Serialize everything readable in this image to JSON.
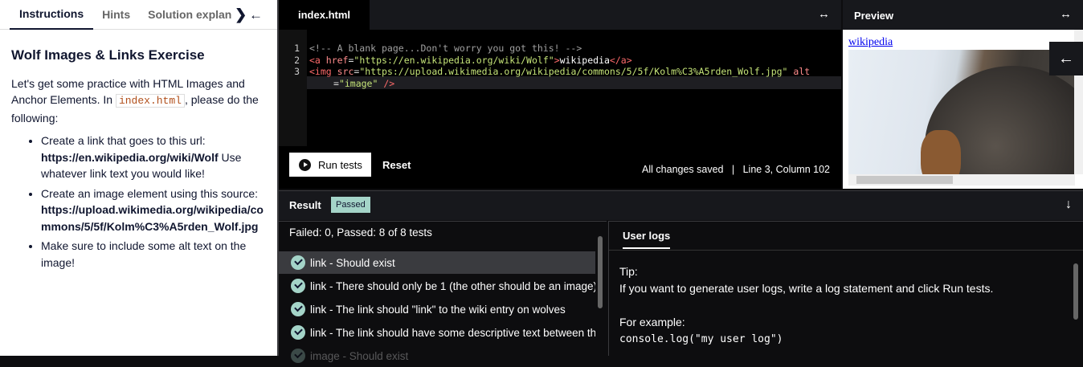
{
  "left": {
    "tabs": [
      "Instructions",
      "Hints",
      "Solution explanation"
    ],
    "title": "Wolf Images & Links Exercise",
    "intro_1": "Let's get some practice with HTML Images and Anchor Elements.  In ",
    "intro_code": "index.html",
    "intro_2": ", please do the following:",
    "bullets": [
      {
        "text": "Create a link that goes to this url: ",
        "bold": "https://en.wikipedia.org/wiki/Wolf",
        "after": " Use whatever link text you would like!"
      },
      {
        "text": "Create an image element using this source: ",
        "bold": "https://upload.wikimedia.org/wikipedia/commons/5/5f/Kolm%C3%A5rden_Wolf.jpg",
        "after": ""
      },
      {
        "text": "Make sure to include some alt text on the image!",
        "bold": "",
        "after": ""
      }
    ]
  },
  "editor": {
    "tab": "index.html",
    "lines": [
      "1",
      "2",
      "3"
    ],
    "line1": "<!-- A blank page...Don't worry you got this! -->",
    "line2": {
      "open": "<a ",
      "attr": "href",
      "eq": "=",
      "val": "\"https://en.wikipedia.org/wiki/Wolf\"",
      "close": ">",
      "text": "wikipedia",
      "end": "</a>"
    },
    "line3": {
      "open": "<img ",
      "attr": "src",
      "eq": "=",
      "val": "\"https://upload.wikimedia.org/wikipedia/commons/5/5f/Kolm%C3%A5rden_Wolf.jpg\"",
      "attr2": " alt"
    },
    "line3b": {
      "eq": "=",
      "val": "\"image\"",
      "close": " />"
    },
    "run_label": "Run tests",
    "reset_label": "Reset",
    "status": "All changes saved   |   Line 3, Column 102"
  },
  "preview": {
    "title": "Preview",
    "link": "wikipedia"
  },
  "result": {
    "label": "Result",
    "badge": "Passed",
    "summary": "Failed: 0, Passed: 8 of 8 tests",
    "tests": [
      "link - Should exist",
      "link - There should only be 1 (the other should be an image)",
      "link - The link should \"link\" to the wiki entry on wolves",
      "link - The link should have some descriptive text between the tags",
      "image - Should exist"
    ]
  },
  "logs": {
    "tab": "User logs",
    "tip": "Tip:",
    "line": "If you want to generate user logs, write a log statement and click Run tests.",
    "example": "For example:",
    "code": "console.log(\"my user log\")"
  },
  "colors": {
    "accent": "#a4d4c8",
    "highlight": "#3a3b3f"
  }
}
